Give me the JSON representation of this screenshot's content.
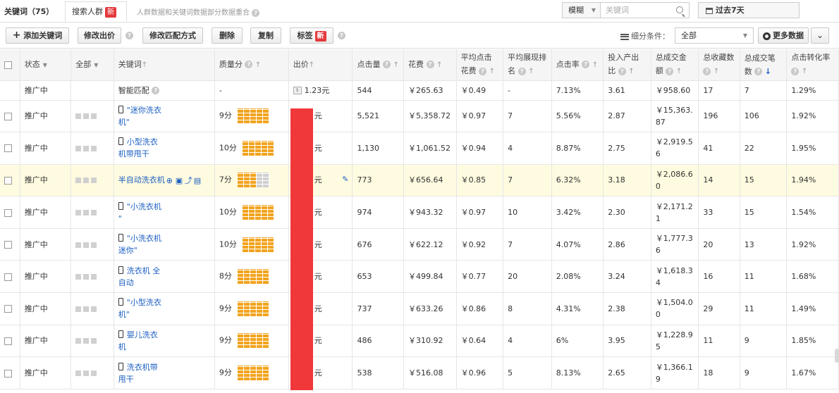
{
  "tabs": {
    "keywords_label": "关键词（75）",
    "crowd_label": "搜索人群",
    "new_badge": "新",
    "notice": "人群数据和关键词数据部分数据重合"
  },
  "search": {
    "match_mode": "模糊",
    "placeholder": "关键词"
  },
  "date_range": "过去7天",
  "toolbar": {
    "add_keyword": "添加关键词",
    "modify_bid": "修改出价",
    "modify_match": "修改匹配方式",
    "delete": "删除",
    "copy": "复制",
    "tag": "标签",
    "tag_badge": "新",
    "segment_label": "细分条件：",
    "segment_value": "全部",
    "more_data": "更多数据"
  },
  "columns": {
    "status": "状态",
    "all": "全部",
    "keyword": "关键词",
    "quality": "质量分",
    "bid": "出价",
    "clicks": "点击量",
    "cost": "花费",
    "avg_cpc": "平均点击花费",
    "avg_rank": "平均展现排名",
    "ctr": "点击率",
    "roi": "投入产出比",
    "gmv": "总成交金额",
    "favs": "总收藏数",
    "orders": "总成交笔数",
    "cvr": "点击转化率"
  },
  "smart_row": {
    "status": "推广中",
    "keyword": "智能匹配",
    "quality": "-",
    "bid": "1.23元",
    "clicks": "544",
    "cost": "￥265.63",
    "avg_cpc": "￥0.49",
    "avg_rank": "-",
    "ctr": "7.13%",
    "roi": "3.61",
    "gmv": "￥958.60",
    "favs": "17",
    "orders": "7",
    "cvr": "1.29%"
  },
  "rows": [
    {
      "status": "推广中",
      "kw1": "\"迷你洗衣",
      "kw2": "机\"",
      "quality": "9分",
      "bid": "元",
      "clicks": "5,521",
      "cost": "￥5,358.72",
      "avg_cpc": "￥0.97",
      "avg_rank": "7",
      "ctr": "5.56%",
      "roi": "2.87",
      "gmv1": "￥15,363.",
      "gmv2": "87",
      "favs": "196",
      "orders": "106",
      "cvr": "1.92%"
    },
    {
      "status": "推广中",
      "kw1": "小型洗衣",
      "kw2": "机带甩干",
      "quality": "10分",
      "bid": "元",
      "clicks": "1,130",
      "cost": "￥1,061.52",
      "avg_cpc": "￥0.94",
      "avg_rank": "4",
      "ctr": "8.87%",
      "roi": "2.75",
      "gmv1": "￥2,919.5",
      "gmv2": "6",
      "favs": "41",
      "orders": "22",
      "cvr": "1.95%"
    },
    {
      "status": "推广中",
      "kw1": "半自动洗衣机",
      "kw2": "",
      "quality": "7分",
      "bid": "元",
      "clicks": "773",
      "cost": "￥656.64",
      "avg_cpc": "￥0.85",
      "avg_rank": "7",
      "ctr": "6.32%",
      "roi": "3.18",
      "gmv1": "￥2,086.6",
      "gmv2": "0",
      "favs": "14",
      "orders": "15",
      "cvr": "1.94%"
    },
    {
      "status": "推广中",
      "kw1": "\"小洗衣机",
      "kw2": "\"",
      "quality": "10分",
      "bid": "元",
      "clicks": "974",
      "cost": "￥943.32",
      "avg_cpc": "￥0.97",
      "avg_rank": "10",
      "ctr": "3.42%",
      "roi": "2.30",
      "gmv1": "￥2,171.2",
      "gmv2": "1",
      "favs": "33",
      "orders": "15",
      "cvr": "1.54%"
    },
    {
      "status": "推广中",
      "kw1": "\"小洗衣机",
      "kw2": "迷你\"",
      "quality": "10分",
      "bid": "元",
      "clicks": "676",
      "cost": "￥622.12",
      "avg_cpc": "￥0.92",
      "avg_rank": "7",
      "ctr": "4.07%",
      "roi": "2.86",
      "gmv1": "￥1,777.3",
      "gmv2": "6",
      "favs": "20",
      "orders": "13",
      "cvr": "1.92%"
    },
    {
      "status": "推广中",
      "kw1": "洗衣机 全",
      "kw2": "自动",
      "quality": "8分",
      "bid": "元",
      "clicks": "653",
      "cost": "￥499.84",
      "avg_cpc": "￥0.77",
      "avg_rank": "20",
      "ctr": "2.08%",
      "roi": "3.24",
      "gmv1": "￥1,618.3",
      "gmv2": "4",
      "favs": "16",
      "orders": "11",
      "cvr": "1.68%"
    },
    {
      "status": "推广中",
      "kw1": "\"小型洗衣",
      "kw2": "机\"",
      "quality": "9分",
      "bid": "元",
      "clicks": "737",
      "cost": "￥633.26",
      "avg_cpc": "￥0.86",
      "avg_rank": "8",
      "ctr": "4.31%",
      "roi": "2.38",
      "gmv1": "￥1,504.0",
      "gmv2": "0",
      "favs": "29",
      "orders": "11",
      "cvr": "1.49%"
    },
    {
      "status": "推广中",
      "kw1": "婴儿洗衣",
      "kw2": "机",
      "quality": "9分",
      "bid": "元",
      "clicks": "486",
      "cost": "￥310.92",
      "avg_cpc": "￥0.64",
      "avg_rank": "4",
      "ctr": "6%",
      "roi": "3.95",
      "gmv1": "￥1,228.9",
      "gmv2": "5",
      "favs": "11",
      "orders": "9",
      "cvr": "1.85%"
    },
    {
      "status": "推广中",
      "kw1": "洗衣机带",
      "kw2": "甩干",
      "quality": "9分",
      "bid": "元",
      "clicks": "538",
      "cost": "￥516.08",
      "avg_cpc": "￥0.96",
      "avg_rank": "5",
      "ctr": "8.13%",
      "roi": "2.65",
      "gmv1": "￥1,366.1",
      "gmv2": "9",
      "favs": "18",
      "orders": "9",
      "cvr": "1.67%"
    }
  ]
}
